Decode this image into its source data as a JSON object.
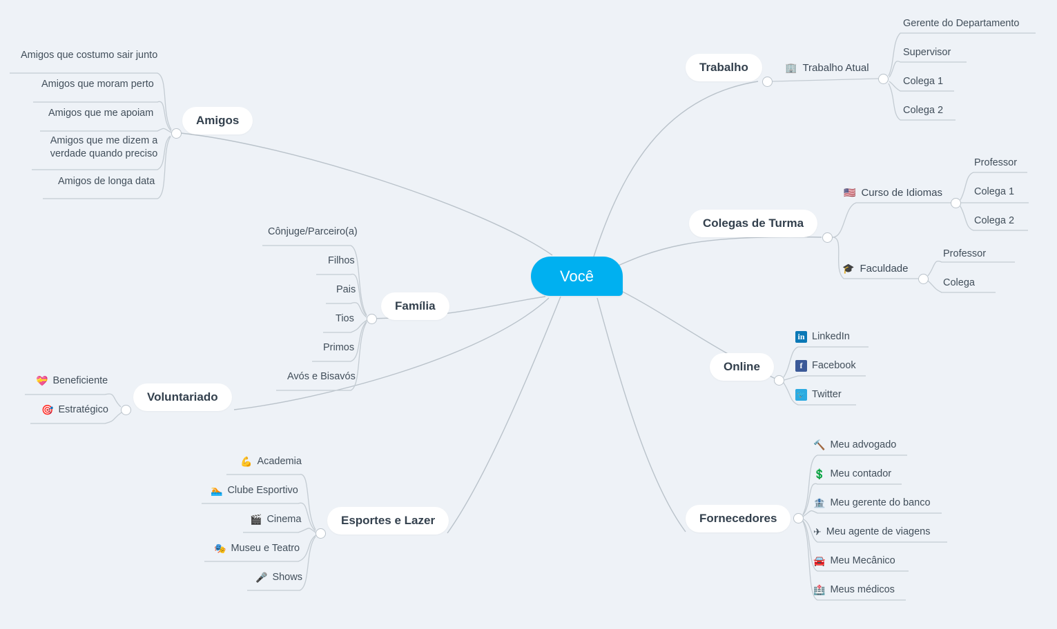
{
  "root": {
    "label": "Você",
    "color": "#00b0f0"
  },
  "theme": {
    "background": "#eef2f7",
    "line": "#b9c2ca",
    "pill_bg": "#ffffff",
    "pill_text": "#33404d",
    "leaf_text": "#414e5a"
  },
  "branches": [
    {
      "id": "trabalho",
      "label": "Trabalho",
      "side": "right",
      "children": [
        {
          "label": "Trabalho Atual",
          "icon": "office-building-icon",
          "glyph": "🏢",
          "children": [
            {
              "label": "Gerente do Departamento"
            },
            {
              "label": "Supervisor"
            },
            {
              "label": "Colega 1"
            },
            {
              "label": "Colega 2"
            }
          ]
        }
      ]
    },
    {
      "id": "colegas-de-turma",
      "label": "Colegas de Turma",
      "side": "right",
      "children": [
        {
          "label": "Curso de Idiomas",
          "icon": "us-flag-icon",
          "glyph": "🇺🇸",
          "children": [
            {
              "label": "Professor"
            },
            {
              "label": "Colega 1"
            },
            {
              "label": "Colega 2"
            }
          ]
        },
        {
          "label": "Faculdade",
          "icon": "graduation-cap-icon",
          "glyph": "🎓",
          "children": [
            {
              "label": "Professor"
            },
            {
              "label": "Colega"
            }
          ]
        }
      ]
    },
    {
      "id": "online",
      "label": "Online",
      "side": "right",
      "children": [
        {
          "label": "LinkedIn",
          "icon": "linkedin-icon",
          "brand": "linkedin",
          "brand_glyph": "in"
        },
        {
          "label": "Facebook",
          "icon": "facebook-icon",
          "brand": "facebook",
          "brand_glyph": "f"
        },
        {
          "label": "Twitter",
          "icon": "twitter-icon",
          "brand": "twitter",
          "brand_glyph": "🐦"
        }
      ]
    },
    {
      "id": "fornecedores",
      "label": "Fornecedores",
      "side": "right",
      "children": [
        {
          "label": "Meu advogado",
          "icon": "gavel-icon",
          "glyph": "🔨"
        },
        {
          "label": "Meu contador",
          "icon": "dollar-sign-icon",
          "glyph": "💲"
        },
        {
          "label": "Meu gerente do banco",
          "icon": "bank-icon",
          "glyph": "🏦"
        },
        {
          "label": "Meu agente de viagens",
          "icon": "airplane-icon",
          "glyph": "✈"
        },
        {
          "label": "Meu Mecânico",
          "icon": "car-icon",
          "glyph": "🚘"
        },
        {
          "label": "Meus médicos",
          "icon": "hospital-icon",
          "glyph": "🏥"
        }
      ]
    },
    {
      "id": "amigos",
      "label": "Amigos",
      "side": "left",
      "children": [
        {
          "label": "Amigos que costumo sair junto"
        },
        {
          "label": "Amigos que moram perto"
        },
        {
          "label": "Amigos que me apoiam"
        },
        {
          "label": "Amigos que me dizem a verdade quando preciso"
        },
        {
          "label": "Amigos de longa data"
        }
      ]
    },
    {
      "id": "familia",
      "label": "Família",
      "side": "left",
      "children": [
        {
          "label": "Cônjuge/Parceiro(a)"
        },
        {
          "label": "Filhos"
        },
        {
          "label": "Pais"
        },
        {
          "label": "Tios"
        },
        {
          "label": "Primos"
        },
        {
          "label": "Avós e Bisavós"
        }
      ]
    },
    {
      "id": "voluntariado",
      "label": "Voluntariado",
      "side": "left",
      "children": [
        {
          "label": "Beneficiente",
          "icon": "heart-gift-icon",
          "glyph": "💝"
        },
        {
          "label": "Estratégico",
          "icon": "target-icon",
          "glyph": "🎯"
        }
      ]
    },
    {
      "id": "esportes-e-lazer",
      "label": "Esportes e Lazer",
      "side": "left",
      "children": [
        {
          "label": "Academia",
          "icon": "biceps-icon",
          "glyph": "💪"
        },
        {
          "label": "Clube Esportivo",
          "icon": "swimmer-icon",
          "glyph": "🏊"
        },
        {
          "label": "Cinema",
          "icon": "clapper-board-icon",
          "glyph": "🎬"
        },
        {
          "label": "Museu e Teatro",
          "icon": "theater-masks-icon",
          "glyph": "🎭"
        },
        {
          "label": "Shows",
          "icon": "microphone-icon",
          "glyph": "🎤"
        }
      ]
    }
  ]
}
